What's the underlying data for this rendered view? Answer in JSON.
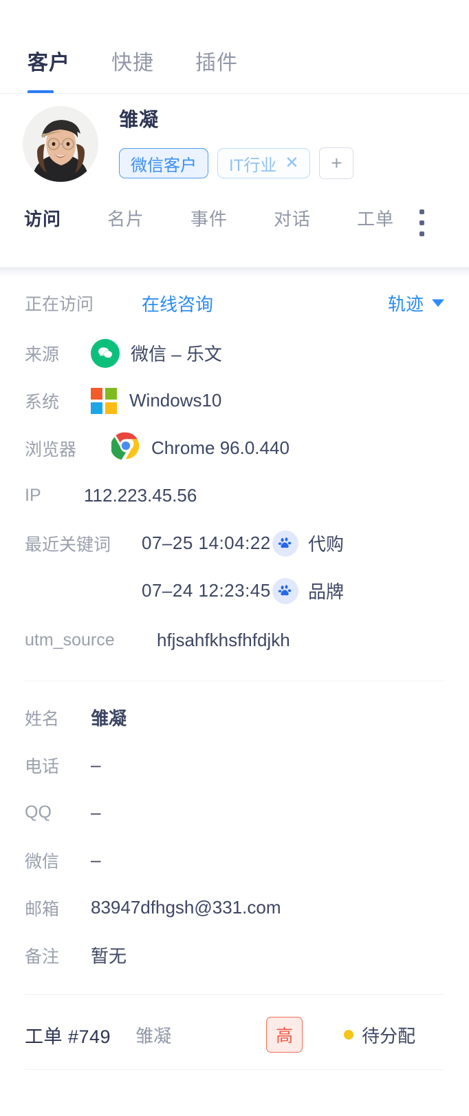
{
  "top_tabs": [
    {
      "label": "客户",
      "active": true
    },
    {
      "label": "快捷",
      "active": false
    },
    {
      "label": "插件",
      "active": false
    }
  ],
  "profile": {
    "name": "雏凝",
    "tags": [
      {
        "label": "微信客户",
        "removable": false
      },
      {
        "label": "IT行业",
        "removable": true,
        "close": "✕"
      }
    ],
    "add_tag_label": "+",
    "menu_icon": "more-vertical-icon"
  },
  "sub_tabs": [
    {
      "label": "访问",
      "active": true
    },
    {
      "label": "名片",
      "active": false
    },
    {
      "label": "事件",
      "active": false
    },
    {
      "label": "对话",
      "active": false
    },
    {
      "label": "工单",
      "active": false
    }
  ],
  "visit": {
    "current_label": "正在访问",
    "current_value": "在线咨询",
    "track_label": "轨迹",
    "source_label": "来源",
    "source_value": "微信 – 乐文",
    "os_label": "系统",
    "os_value": "Windows10",
    "browser_label": "浏览器",
    "browser_value": "Chrome 96.0.440",
    "ip_label": "IP",
    "ip_value": "112.223.45.56",
    "keywords_label": "最近关键词",
    "keywords": [
      {
        "time": "07–25 14:04:22",
        "word": "代购",
        "engine": "baidu-paw-icon"
      },
      {
        "time": "07–24 12:23:45",
        "word": "品牌",
        "engine": "baidu-paw-icon"
      }
    ],
    "utm_label": "utm_source",
    "utm_value": "hfjsahfkhsfhfdjkh"
  },
  "contact": [
    {
      "label": "姓名",
      "value": "雏凝"
    },
    {
      "label": "电话",
      "value": "–"
    },
    {
      "label": "QQ",
      "value": "–"
    },
    {
      "label": "微信",
      "value": "–"
    },
    {
      "label": "邮箱",
      "value": "83947dfhgsh@331.com"
    },
    {
      "label": "备注",
      "value": "暂无"
    }
  ],
  "ticket": {
    "id": "工单 #749",
    "customer": "雏凝",
    "priority": "高",
    "status": "待分配"
  },
  "colors": {
    "accent_blue": "#2a7df4",
    "link_blue": "#2b8cf5",
    "tag_blue": "#3d8ff5",
    "tag_light_blue": "#8fc2f4",
    "wechat_green": "#0cc07c",
    "priority_red": "#f05a47",
    "status_yellow": "#f5c518",
    "label_gray": "#9aa0ac",
    "text_dark": "#2e3553"
  }
}
